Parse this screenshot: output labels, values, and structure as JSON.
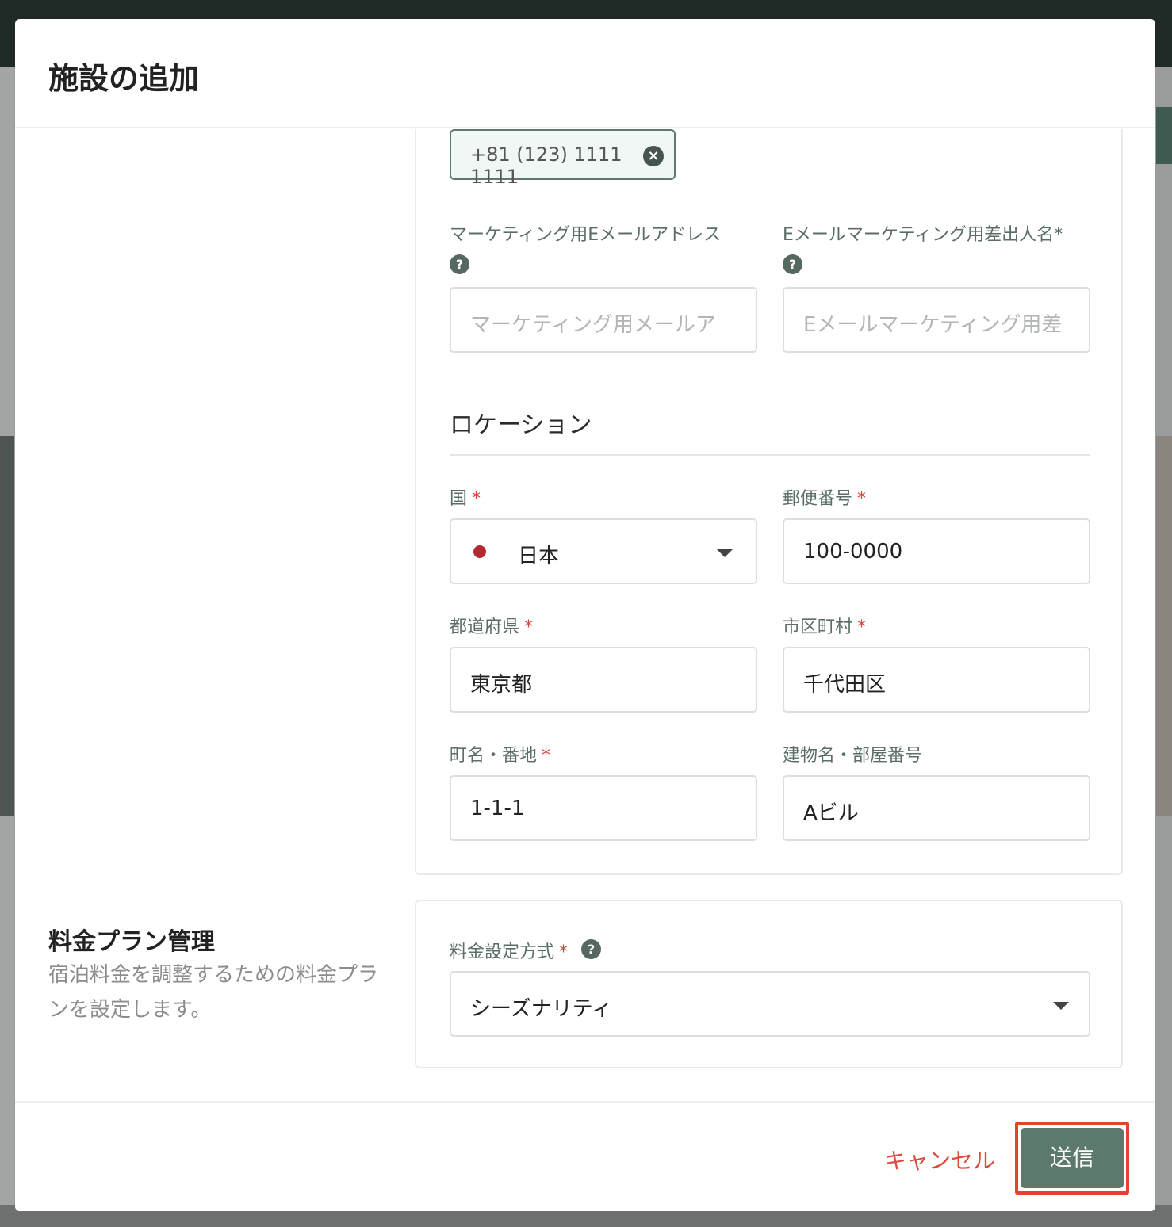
{
  "modal": {
    "title": "施設の追加"
  },
  "contact": {
    "phone_chip": "+81 (123) 1111 1111",
    "marketing_email_label": "マーケティング用Eメールアドレス",
    "marketing_email_placeholder": "マーケティング用メールア",
    "sender_name_label": "Eメールマーケティング用差出人名*",
    "sender_name_placeholder": "Eメールマーケティング用差"
  },
  "location": {
    "section_title": "ロケーション",
    "country": {
      "label": "国",
      "value": "日本"
    },
    "postal_code": {
      "label": "郵便番号",
      "value": "100-0000"
    },
    "prefecture": {
      "label": "都道府県",
      "value": "東京都"
    },
    "city": {
      "label": "市区町村",
      "value": "千代田区"
    },
    "street": {
      "label": "町名・番地",
      "value": "1-1-1"
    },
    "building": {
      "label": "建物名・部屋番号",
      "value": "Aビル"
    }
  },
  "pricing": {
    "side_title": "料金プラン管理",
    "side_description": "宿泊料金を調整するための料金プランを設定します。",
    "method_label": "料金設定方式",
    "method_value": "シーズナリティ"
  },
  "footer": {
    "cancel_label": "キャンセル",
    "submit_label": "送信"
  },
  "required_mark": "*",
  "help_mark": "?",
  "colors": {
    "accent": "#5c7a6c",
    "danger": "#dc4a3c",
    "flag": "#b42832"
  },
  "icons": {
    "chip_close": "close-circle-icon",
    "help": "question-circle-icon",
    "dropdown": "caret-down-icon",
    "flag": "japan-flag-icon"
  }
}
